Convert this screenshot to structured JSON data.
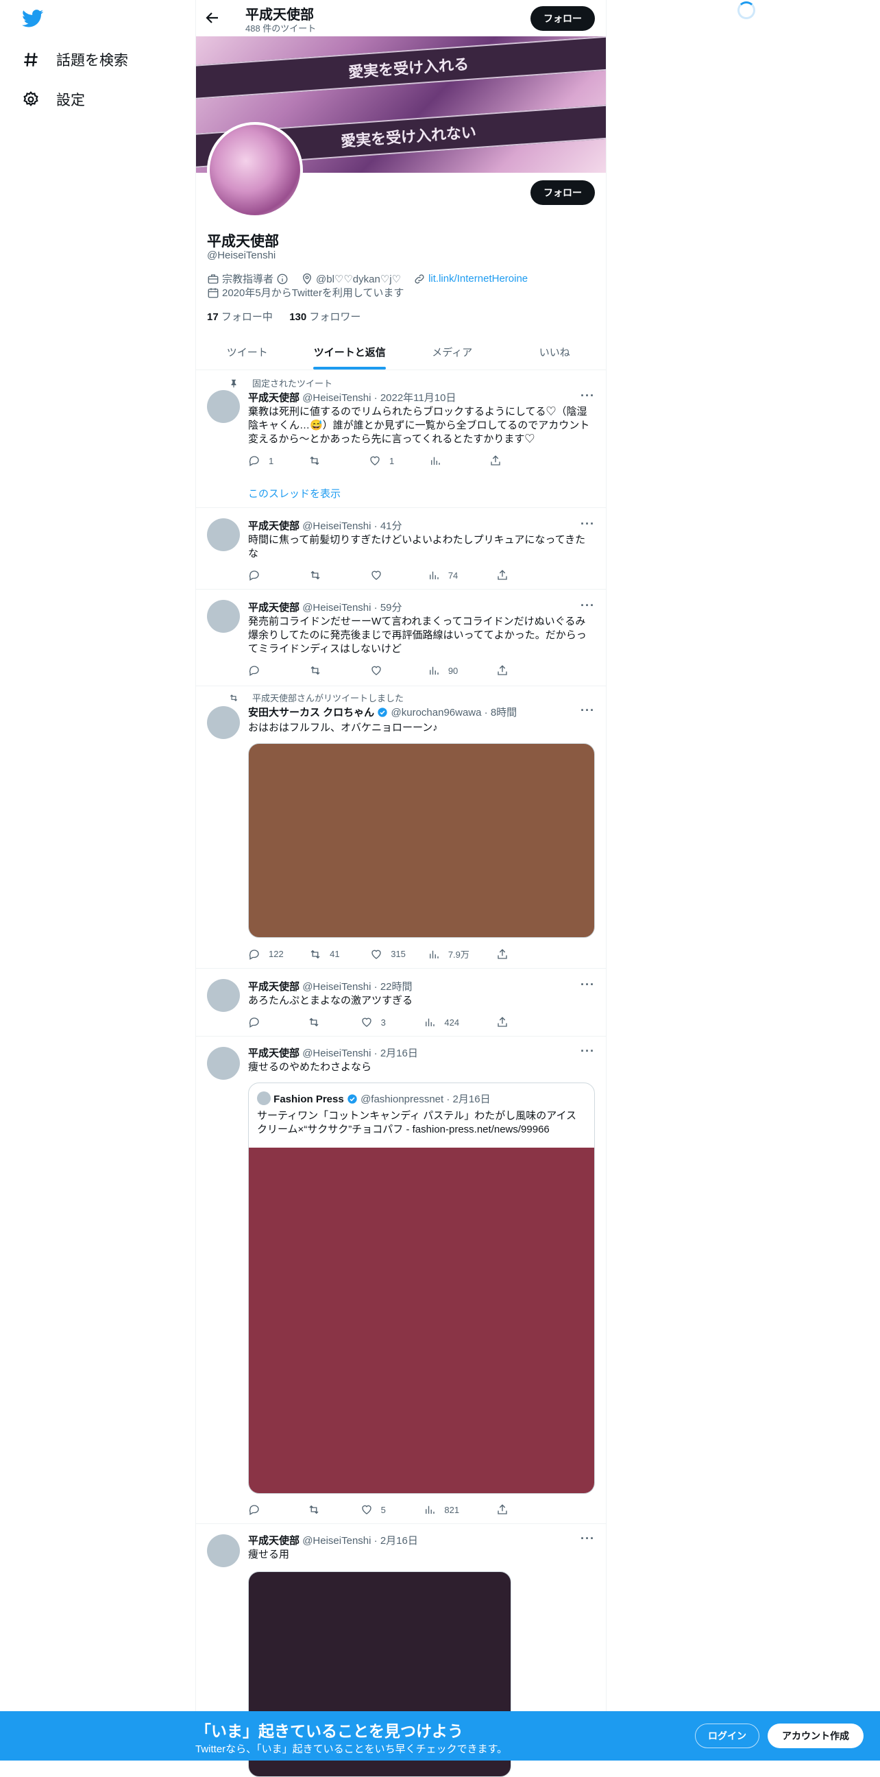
{
  "nav": {
    "items": [
      {
        "label": "話題を検索",
        "icon": "hashtag-icon"
      },
      {
        "label": "設定",
        "icon": "gear-icon"
      }
    ]
  },
  "topbar": {
    "name": "平成天使部",
    "tweet_count": "488 件のツイート",
    "follow_label": "フォロー"
  },
  "profile": {
    "banner_line1": "愛実を受け入れる",
    "banner_line2": "愛実を受け入れない",
    "follow_label": "フォロー",
    "name": "平成天使部",
    "handle": "@HeiseiTenshi",
    "category": "宗教指導者",
    "location": "@bl♡♡dykan♡j♡",
    "link": "lit.link/InternetHeroine",
    "joined": "2020年5月からTwitterを利用しています",
    "following_count": "17",
    "following_label": "フォロー中",
    "followers_count": "130",
    "followers_label": "フォロワー"
  },
  "tabs": [
    {
      "label": "ツイート",
      "active": false
    },
    {
      "label": "ツイートと返信",
      "active": true
    },
    {
      "label": "メディア",
      "active": false
    },
    {
      "label": "いいね",
      "active": false
    }
  ],
  "tweets": [
    {
      "pinned_label": "固定されたツイート",
      "name": "平成天使部",
      "handle": "@HeiseiTenshi",
      "time": "2022年11月10日",
      "text": "棄教は死刑に値するのでリムられたらブロックするようにしてる♡（陰湿陰キャくん…😅）誰が誰とか見ずに一覧から全ブロしてるのでアカウント変えるから〜とかあったら先に言ってくれるとたすかります♡",
      "reply": "1",
      "retweet": "",
      "like": "1",
      "views": "",
      "show_thread": "このスレッドを表示"
    },
    {
      "name": "平成天使部",
      "handle": "@HeiseiTenshi",
      "time": "41分",
      "text": "時間に焦って前髪切りすぎたけどいよいよわたしプリキュアになってきたな",
      "reply": "",
      "retweet": "",
      "like": "",
      "views": "74"
    },
    {
      "name": "平成天使部",
      "handle": "@HeiseiTenshi",
      "time": "59分",
      "text": "発売前コライドンだせーーWて言われまくってコライドンだけぬいぐるみ爆余りしてたのに発売後まじで再評価路線はいっててよかった。だからってミライドンディスはしないけど",
      "reply": "",
      "retweet": "",
      "like": "",
      "views": "90"
    },
    {
      "retweet_label": "平成天使部さんがリツイートしました",
      "name": "安田大サーカス クロちゃん",
      "handle": "@kurochan96wawa",
      "time": "8時間",
      "text": "おはおはフルフル、オバケニョローーン♪",
      "media_color": "#8a5a42",
      "reply": "122",
      "retweet": "41",
      "like": "315",
      "views": "7.9万"
    },
    {
      "name": "平成天使部",
      "handle": "@HeiseiTenshi",
      "time": "22時間",
      "text": "あろたんぷとまよなの激アツすぎる",
      "reply": "",
      "retweet": "",
      "like": "3",
      "views": "424"
    },
    {
      "name": "平成天使部",
      "handle": "@HeiseiTenshi",
      "time": "2月16日",
      "text": "痩せるのやめたわさよなら",
      "quote": {
        "name": "Fashion Press",
        "handle": "@fashionpressnet",
        "time": "2月16日",
        "text": "サーティワン「コットンキャンディ パステル」わたがし風味のアイスクリーム×“サクサク”チョコパフ - fashion-press.net/news/99966",
        "media_color": "#8a3446"
      },
      "reply": "",
      "retweet": "",
      "like": "5",
      "views": "821"
    },
    {
      "name": "平成天使部",
      "handle": "@HeiseiTenshi",
      "time": "2月16日",
      "text": "痩せる用",
      "media_color": "#2e1f2e"
    }
  ],
  "bottombar": {
    "title": "「いま」起きていることを見つけよう",
    "subtitle": "Twitterなら、「いま」起きていることをいち早くチェックできます。",
    "login_label": "ログイン",
    "signup_label": "アカウント作成"
  },
  "colors": {
    "accent": "#1d9bf0",
    "text": "#0f1419",
    "muted": "#536471"
  }
}
